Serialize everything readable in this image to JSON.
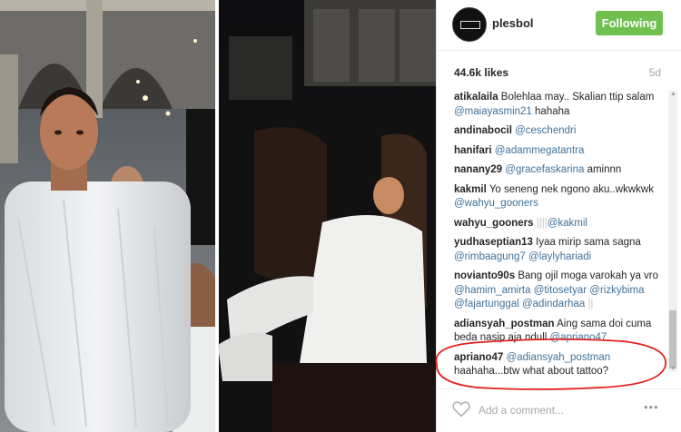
{
  "post": {
    "username": "plesbol",
    "follow_label": "Following",
    "likes": "44.6k likes",
    "age": "5d"
  },
  "comments": [
    {
      "user": "atikalaila",
      "parts": [
        {
          "t": "Bolehlaa may.. Skalian ttip salam "
        },
        {
          "m": "@maiayasmin21"
        },
        {
          "t": " hahaha"
        }
      ]
    },
    {
      "user": "andinabocil",
      "parts": [
        {
          "m": "@ceschendri"
        }
      ]
    },
    {
      "user": "hanifari",
      "parts": [
        {
          "m": "@adammegatantra"
        }
      ]
    },
    {
      "user": "nanany29",
      "parts": [
        {
          "m": "@gracefaskarina"
        },
        {
          "t": " aminnn"
        }
      ]
    },
    {
      "user": "kakmil",
      "parts": [
        {
          "t": "Yo seneng nek ngono aku..wkwkwk "
        },
        {
          "m": "@wahyu_gooners"
        }
      ]
    },
    {
      "user": "wahyu_gooners",
      "parts": [
        {
          "f": "||||"
        },
        {
          "m": "@kakmil"
        }
      ]
    },
    {
      "user": "yudhaseptian13",
      "parts": [
        {
          "t": "Iyaa mirip sama sagna "
        },
        {
          "m": "@rimbaagung7"
        },
        {
          "t": " "
        },
        {
          "m": "@laylyhariadi"
        }
      ]
    },
    {
      "user": "novianto90s",
      "parts": [
        {
          "t": "Bang ojil moga varokah ya vro "
        },
        {
          "m": "@hamim_amirta"
        },
        {
          "t": " "
        },
        {
          "m": "@titosetyar"
        },
        {
          "t": " "
        },
        {
          "m": "@rizkybima"
        },
        {
          "t": " "
        },
        {
          "m": "@fajartunggal"
        },
        {
          "t": " "
        },
        {
          "m": "@adindarhaa"
        },
        {
          "f": " ||"
        }
      ]
    },
    {
      "user": "adiansyah_postman",
      "parts": [
        {
          "t": "Aing sama doi cuma beda nasip aja ndull "
        },
        {
          "m": "@apriano47"
        }
      ]
    },
    {
      "user": "apriano47",
      "parts": [
        {
          "m": "@adiansyah_postman"
        },
        {
          "t": " haahaha...btw what about tattoo?"
        }
      ]
    }
  ],
  "footer": {
    "placeholder": "Add a comment...",
    "more": "•••"
  },
  "colors": {
    "follow_bg": "#70c050",
    "mention": "#3f729b",
    "annotation_oval": "#e0201c"
  }
}
